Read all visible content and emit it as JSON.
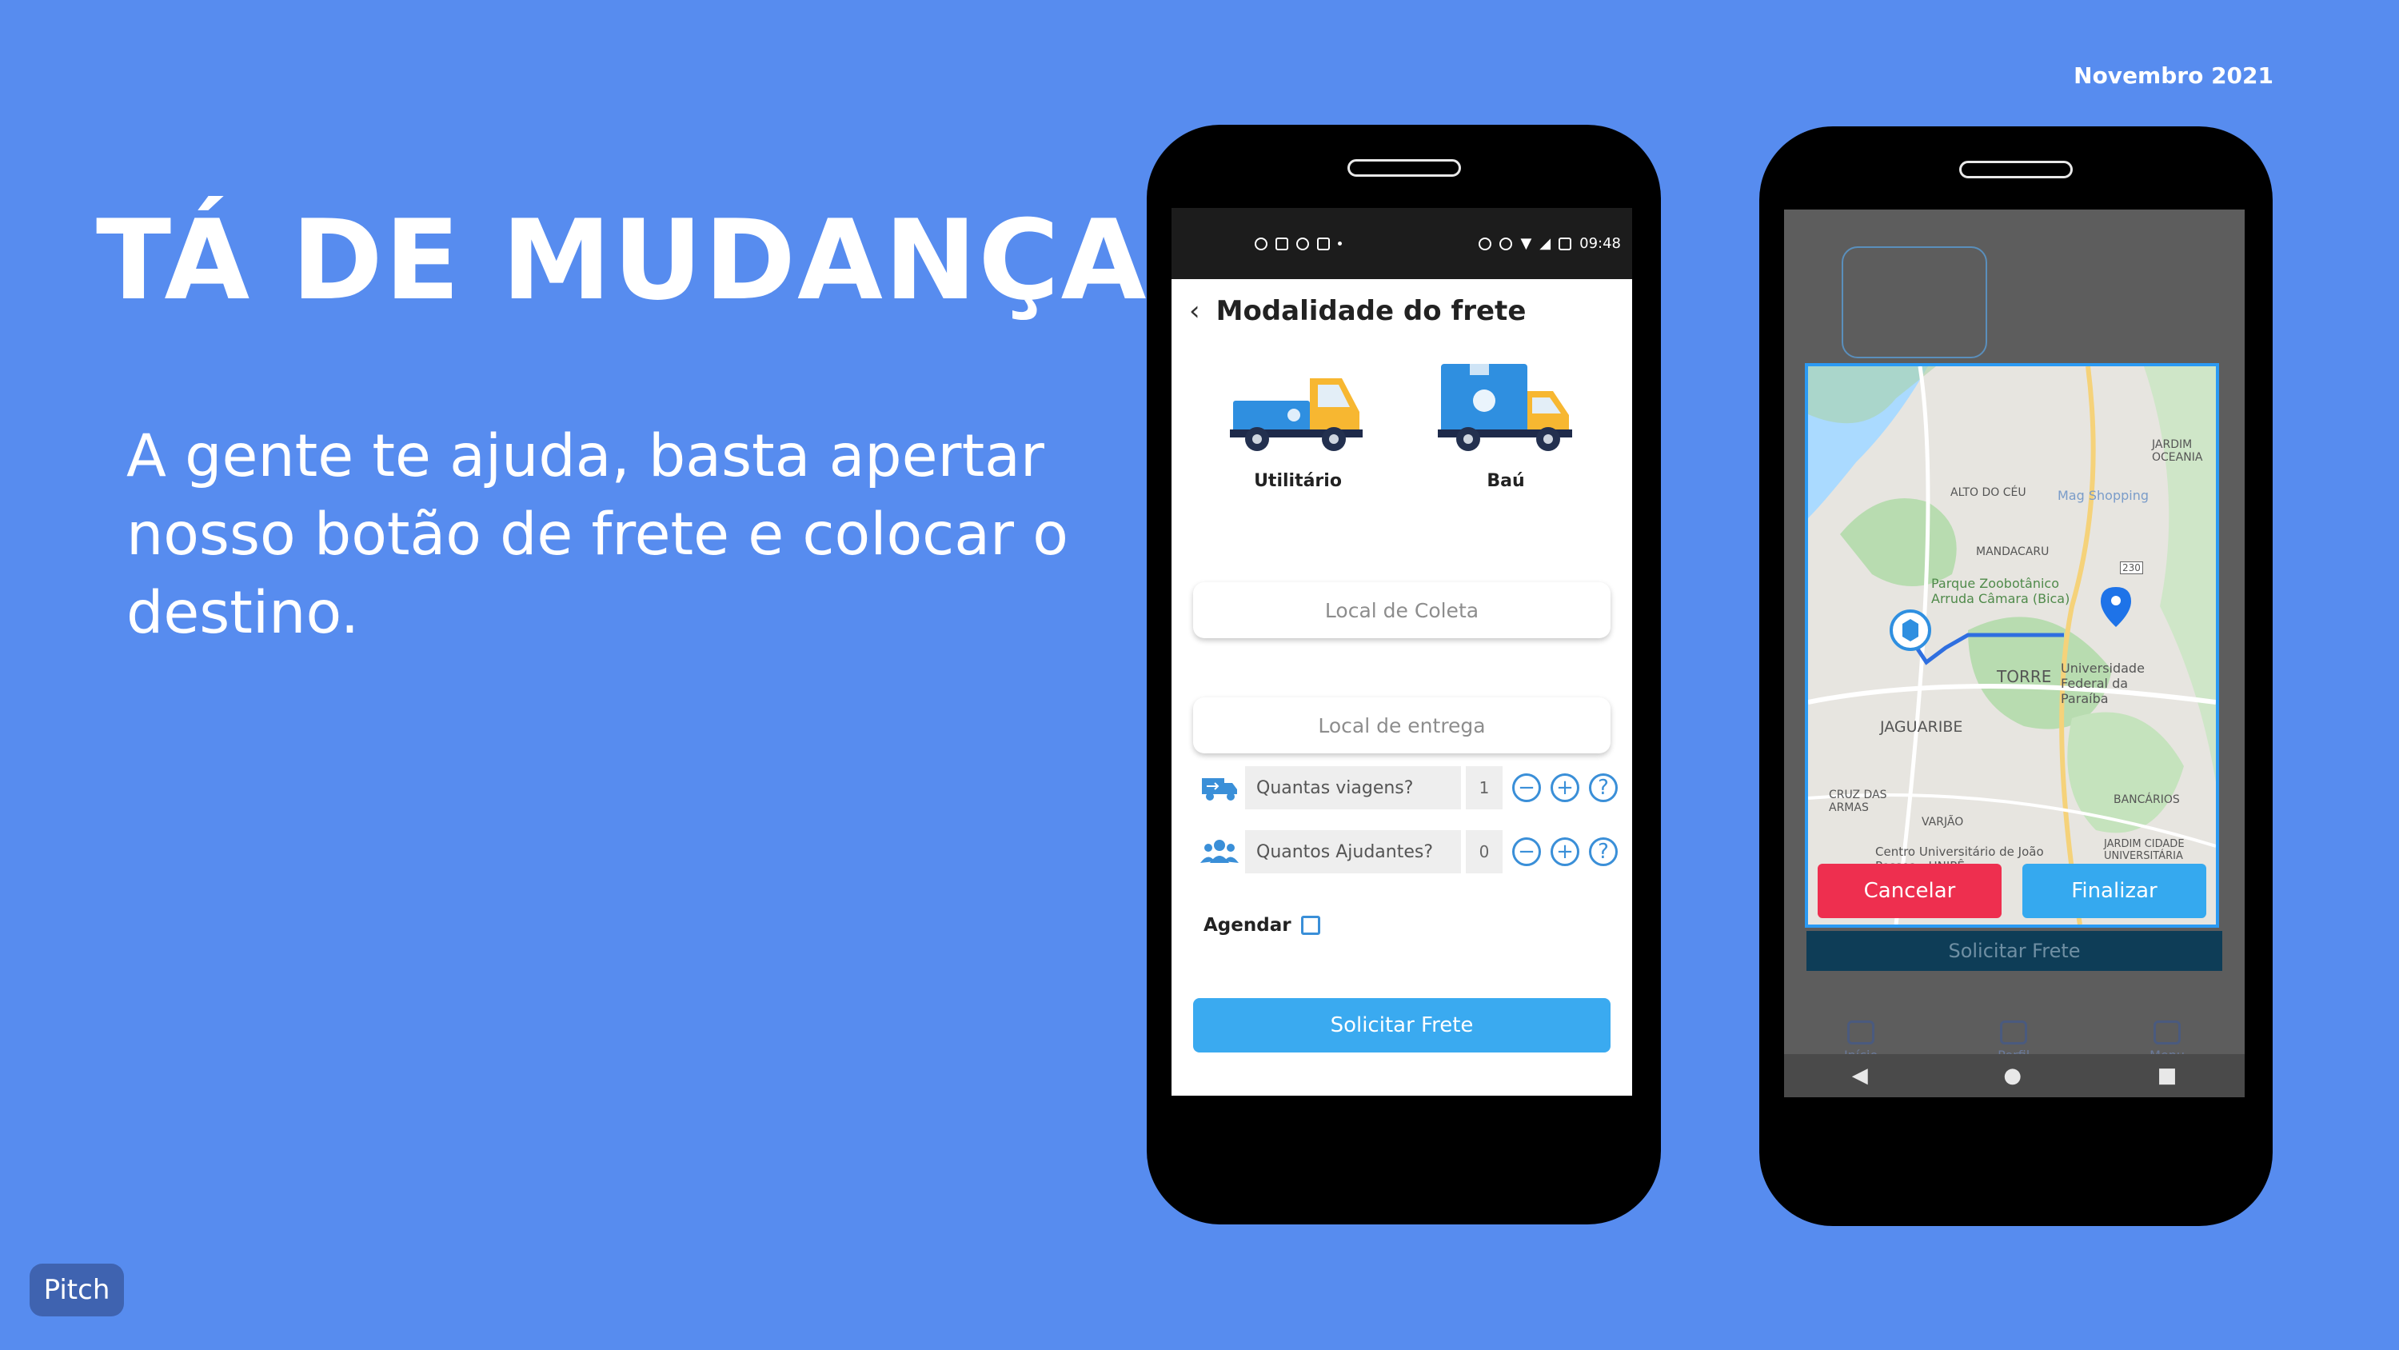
{
  "slide": {
    "date": "Novembro 2021",
    "headline": "TÁ DE MUDANÇA?",
    "subtitle": "A gente te ajuda, basta apertar nosso botão de frete e colocar o destino.",
    "logo": "Pitch"
  },
  "phone1": {
    "status_time": "09:48",
    "title": "Modalidade do frete",
    "vehicles": [
      {
        "label": "Utilitário"
      },
      {
        "label": "Baú"
      }
    ],
    "pickup_placeholder": "Local de Coleta",
    "delivery_placeholder": "Local de entrega",
    "trips": {
      "label": "Quantas viagens?",
      "value": "1"
    },
    "helpers": {
      "label": "Quantos Ajudantes?",
      "value": "0"
    },
    "minus": "−",
    "plus": "+",
    "help": "?",
    "schedule_label": "Agendar",
    "submit_label": "Solicitar Frete"
  },
  "phone2": {
    "map_labels": {
      "jardim_oceania": "JARDIM OCEANIA",
      "alto_do_ceu": "ALTO DO CÉU",
      "mag_shopping": "Mag Shopping",
      "mandacaru": "MANDACARU",
      "parque": "Parque Zoobotânico Arruda Câmara (Bica)",
      "torre": "TORRE",
      "universidade": "Universidade Federal da Paraíba",
      "jaguaribe": "JAGUARIBE",
      "cruz_das_armas": "CRUZ DAS ARMAS",
      "bancarios": "BANCÁRIOS",
      "varjao": "VARJÃO",
      "centro_universitario": "Centro Universitário de João Pessoa - UNIPÊ",
      "jardim_cidade": "JARDIM CIDADE UNIVERSITÁRIA",
      "road_230": "230"
    },
    "cancel_label": "Cancelar",
    "finish_label": "Finalizar",
    "behind_submit_label": "Solicitar Frete",
    "nav": [
      {
        "label": "Início"
      },
      {
        "label": "Perfil"
      },
      {
        "label": "Menu"
      }
    ],
    "sys_back": "◀",
    "sys_home": "●",
    "sys_recent": "■"
  },
  "colors": {
    "background": "#578cef",
    "accent_blue": "#3aaaf0",
    "cancel_red": "#ee2f4f"
  }
}
